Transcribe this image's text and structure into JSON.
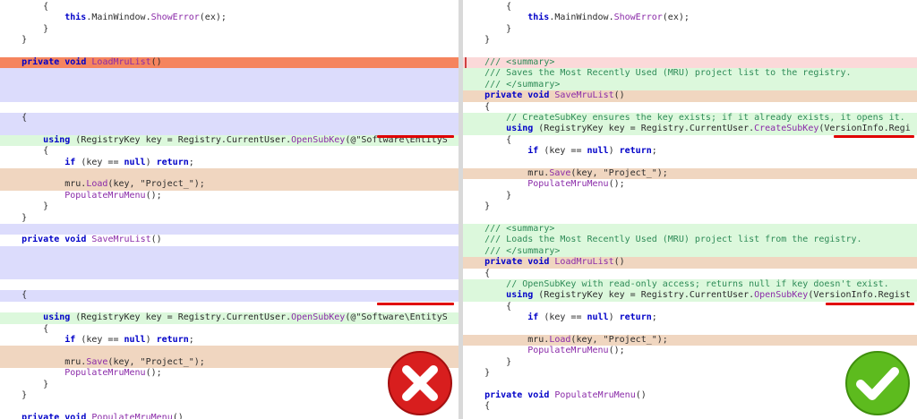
{
  "left": {
    "lines": [
      [
        {
          "t": "        {"
        }
      ],
      [
        {
          "t": "            "
        },
        {
          "t": "this",
          "c": "kw"
        },
        {
          "t": ".MainWindow."
        },
        {
          "t": "ShowError",
          "c": "fn"
        },
        {
          "t": "(ex);"
        }
      ],
      [
        {
          "t": "        }"
        }
      ],
      [
        {
          "t": "    }"
        }
      ],
      [],
      [
        {
          "t": "    "
        },
        {
          "t": "private",
          "c": "kw"
        },
        {
          "t": " "
        },
        {
          "t": "void",
          "c": "kw"
        },
        {
          "t": " "
        },
        {
          "t": "LoadMruList",
          "c": "fn"
        },
        {
          "t": "()"
        }
      ],
      [],
      [],
      [],
      [],
      [
        {
          "t": "    {"
        }
      ],
      [],
      [
        {
          "t": "        "
        },
        {
          "t": "using",
          "c": "kw"
        },
        {
          "t": " (RegistryKey key = Registry.CurrentUser."
        },
        {
          "t": "OpenSubKey",
          "c": "fn"
        },
        {
          "t": "(@\"Software\\EntityS"
        }
      ],
      [
        {
          "t": "        {"
        }
      ],
      [
        {
          "t": "            "
        },
        {
          "t": "if",
          "c": "kw"
        },
        {
          "t": " (key == "
        },
        {
          "t": "null",
          "c": "kw"
        },
        {
          "t": ") "
        },
        {
          "t": "return",
          "c": "kw"
        },
        {
          "t": ";"
        }
      ],
      [],
      [
        {
          "t": "            mru."
        },
        {
          "t": "Load",
          "c": "fn"
        },
        {
          "t": "(key, \"Project_\");"
        }
      ],
      [
        {
          "t": "            "
        },
        {
          "t": "PopulateMruMenu",
          "c": "fn"
        },
        {
          "t": "();"
        }
      ],
      [
        {
          "t": "        }"
        }
      ],
      [
        {
          "t": "    }"
        }
      ],
      [],
      [
        {
          "t": "    "
        },
        {
          "t": "private",
          "c": "kw"
        },
        {
          "t": " "
        },
        {
          "t": "void",
          "c": "kw"
        },
        {
          "t": " "
        },
        {
          "t": "SaveMruList",
          "c": "fn"
        },
        {
          "t": "()"
        }
      ],
      [],
      [],
      [],
      [],
      [
        {
          "t": "    {"
        }
      ],
      [],
      [
        {
          "t": "        "
        },
        {
          "t": "using",
          "c": "kw"
        },
        {
          "t": " (RegistryKey key = Registry.CurrentUser."
        },
        {
          "t": "OpenSubKey",
          "c": "fn"
        },
        {
          "t": "(@\"Software\\EntityS"
        }
      ],
      [
        {
          "t": "        {"
        }
      ],
      [
        {
          "t": "            "
        },
        {
          "t": "if",
          "c": "kw"
        },
        {
          "t": " (key == "
        },
        {
          "t": "null",
          "c": "kw"
        },
        {
          "t": ") "
        },
        {
          "t": "return",
          "c": "kw"
        },
        {
          "t": ";"
        }
      ],
      [],
      [
        {
          "t": "            mru."
        },
        {
          "t": "Save",
          "c": "fn"
        },
        {
          "t": "(key, \"Project_\");"
        }
      ],
      [
        {
          "t": "            "
        },
        {
          "t": "PopulateMruMenu",
          "c": "fn"
        },
        {
          "t": "();"
        }
      ],
      [
        {
          "t": "        }"
        }
      ],
      [
        {
          "t": "    }"
        }
      ],
      [],
      [
        {
          "t": "    "
        },
        {
          "t": "private",
          "c": "kw"
        },
        {
          "t": " "
        },
        {
          "t": "void",
          "c": "kw"
        },
        {
          "t": " "
        },
        {
          "t": "PopulateMruMenu",
          "c": "fn"
        },
        {
          "t": "()"
        }
      ],
      [
        {
          "t": "    {"
        }
      ]
    ],
    "verdict_icon": "red-x-icon"
  },
  "right": {
    "lines": [
      [
        {
          "t": "        {"
        }
      ],
      [
        {
          "t": "            "
        },
        {
          "t": "this",
          "c": "kw"
        },
        {
          "t": ".MainWindow."
        },
        {
          "t": "ShowError",
          "c": "fn"
        },
        {
          "t": "(ex);"
        }
      ],
      [
        {
          "t": "        }"
        }
      ],
      [
        {
          "t": "    }"
        }
      ],
      [],
      [
        {
          "t": "    "
        },
        {
          "t": "/// <summary>",
          "c": "cmt"
        }
      ],
      [
        {
          "t": "    "
        },
        {
          "t": "/// Saves the Most Recently Used (MRU) project list to the registry.",
          "c": "cmt"
        }
      ],
      [
        {
          "t": "    "
        },
        {
          "t": "/// </summary>",
          "c": "cmt"
        }
      ],
      [
        {
          "t": "    "
        },
        {
          "t": "private",
          "c": "kw"
        },
        {
          "t": " "
        },
        {
          "t": "void",
          "c": "kw"
        },
        {
          "t": " "
        },
        {
          "t": "SaveMruList",
          "c": "fn"
        },
        {
          "t": "()"
        }
      ],
      [
        {
          "t": "    {"
        }
      ],
      [
        {
          "t": "        "
        },
        {
          "t": "// CreateSubKey ensures the key exists; if it already exists, it opens it.",
          "c": "cmt"
        }
      ],
      [
        {
          "t": "        "
        },
        {
          "t": "using",
          "c": "kw"
        },
        {
          "t": " (RegistryKey key = Registry.CurrentUser."
        },
        {
          "t": "CreateSubKey",
          "c": "fn"
        },
        {
          "t": "(VersionInfo.Regi"
        }
      ],
      [
        {
          "t": "        {"
        }
      ],
      [
        {
          "t": "            "
        },
        {
          "t": "if",
          "c": "kw"
        },
        {
          "t": " (key == "
        },
        {
          "t": "null",
          "c": "kw"
        },
        {
          "t": ") "
        },
        {
          "t": "return",
          "c": "kw"
        },
        {
          "t": ";"
        }
      ],
      [],
      [
        {
          "t": "            mru."
        },
        {
          "t": "Save",
          "c": "fn"
        },
        {
          "t": "(key, \"Project_\");"
        }
      ],
      [
        {
          "t": "            "
        },
        {
          "t": "PopulateMruMenu",
          "c": "fn"
        },
        {
          "t": "();"
        }
      ],
      [
        {
          "t": "        }"
        }
      ],
      [
        {
          "t": "    }"
        }
      ],
      [],
      [
        {
          "t": "    "
        },
        {
          "t": "/// <summary>",
          "c": "cmt"
        }
      ],
      [
        {
          "t": "    "
        },
        {
          "t": "/// Loads the Most Recently Used (MRU) project list from the registry.",
          "c": "cmt"
        }
      ],
      [
        {
          "t": "    "
        },
        {
          "t": "/// </summary>",
          "c": "cmt"
        }
      ],
      [
        {
          "t": "    "
        },
        {
          "t": "private",
          "c": "kw"
        },
        {
          "t": " "
        },
        {
          "t": "void",
          "c": "kw"
        },
        {
          "t": " "
        },
        {
          "t": "LoadMruList",
          "c": "fn"
        },
        {
          "t": "()"
        }
      ],
      [
        {
          "t": "    {"
        }
      ],
      [
        {
          "t": "        "
        },
        {
          "t": "// OpenSubKey with read-only access; returns null if key doesn't exist.",
          "c": "cmt"
        }
      ],
      [
        {
          "t": "        "
        },
        {
          "t": "using",
          "c": "kw"
        },
        {
          "t": " (RegistryKey key = Registry.CurrentUser."
        },
        {
          "t": "OpenSubKey",
          "c": "fn"
        },
        {
          "t": "(VersionInfo.Regist"
        }
      ],
      [
        {
          "t": "        {"
        }
      ],
      [
        {
          "t": "            "
        },
        {
          "t": "if",
          "c": "kw"
        },
        {
          "t": " (key == "
        },
        {
          "t": "null",
          "c": "kw"
        },
        {
          "t": ") "
        },
        {
          "t": "return",
          "c": "kw"
        },
        {
          "t": ";"
        }
      ],
      [],
      [
        {
          "t": "            mru."
        },
        {
          "t": "Load",
          "c": "fn"
        },
        {
          "t": "(key, \"Project_\");"
        }
      ],
      [
        {
          "t": "            "
        },
        {
          "t": "PopulateMruMenu",
          "c": "fn"
        },
        {
          "t": "();"
        }
      ],
      [
        {
          "t": "        }"
        }
      ],
      [
        {
          "t": "    }"
        }
      ],
      [],
      [
        {
          "t": "    "
        },
        {
          "t": "private",
          "c": "kw"
        },
        {
          "t": " "
        },
        {
          "t": "void",
          "c": "kw"
        },
        {
          "t": " "
        },
        {
          "t": "PopulateMruMenu",
          "c": "fn"
        },
        {
          "t": "()"
        }
      ],
      [
        {
          "t": "    {"
        }
      ]
    ],
    "verdict_icon": "green-check-icon"
  },
  "colors": {
    "removed": "#f5845e",
    "removed_light": "#fbd9d9",
    "added": "#dcf8dc",
    "changed": "#f0d6c0",
    "placeholder": "#dcdcfc",
    "underline": "#e00000"
  }
}
